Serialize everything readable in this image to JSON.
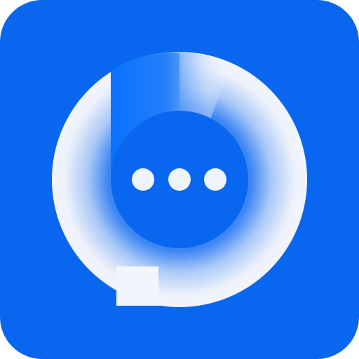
{
  "icon": {
    "name": "chat-bubble-app-icon",
    "colors": {
      "background": "#0867EE",
      "ring_light": "#F3F5FC",
      "ring_glow": "#3D86F3",
      "accent_gradient_start": "#0A72FF",
      "inner_circle": "#0867EE",
      "dots": "#EEF3FC"
    },
    "dot_count": 3
  }
}
